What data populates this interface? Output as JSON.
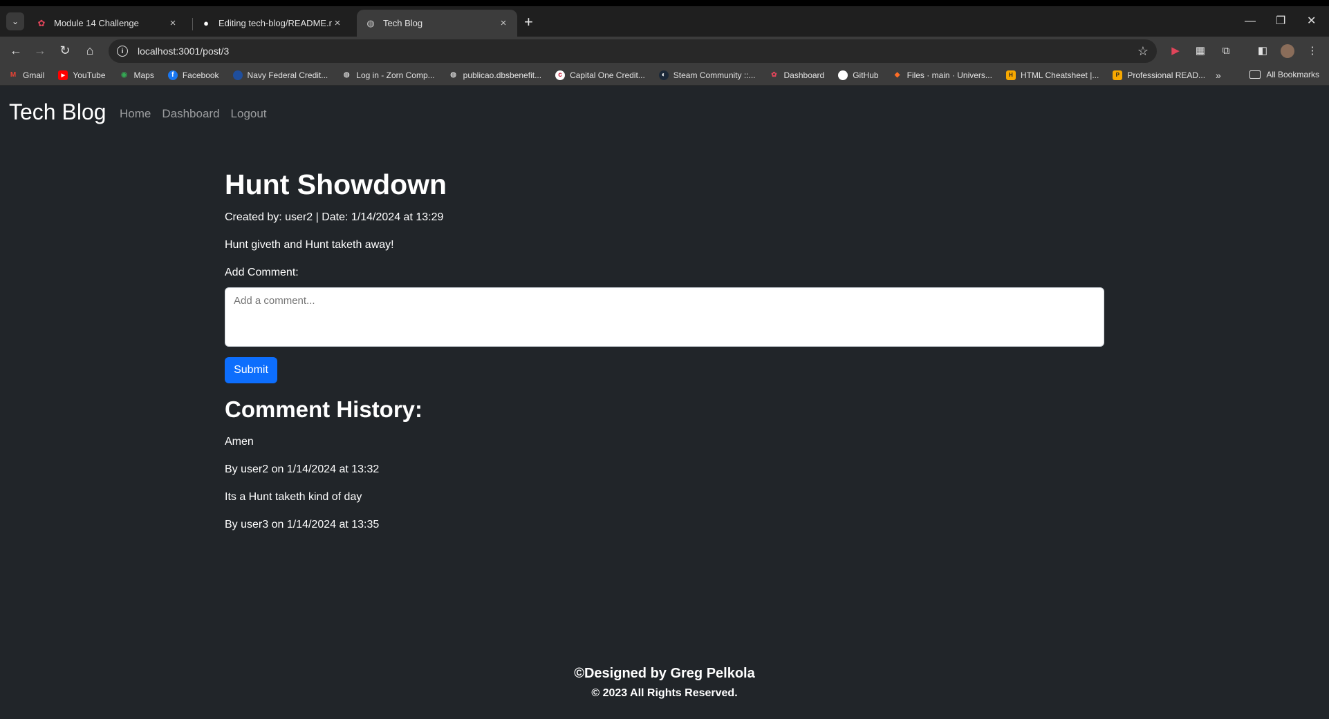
{
  "browser": {
    "tabs": [
      {
        "title": "Module 14 Challenge",
        "icon": "canvas-icon"
      },
      {
        "title": "Editing tech-blog/README.md",
        "icon": "github-icon"
      },
      {
        "title": "Tech Blog",
        "icon": "globe-icon"
      }
    ],
    "url": "localhost:3001/post/3",
    "bookmarks": [
      "Gmail",
      "YouTube",
      "Maps",
      "Facebook",
      "Navy Federal Credit...",
      "Log in - Zorn Comp...",
      "publicao.dbsbenefit...",
      "Capital One Credit...",
      "Steam Community ::...",
      "Dashboard",
      "GitHub",
      "Files · main · Univers...",
      "HTML Cheatsheet |...",
      "Professional READ..."
    ],
    "all_bookmarks": "All Bookmarks"
  },
  "nav": {
    "brand": "Tech Blog",
    "links": [
      "Home",
      "Dashboard",
      "Logout"
    ]
  },
  "post": {
    "title": "Hunt Showdown",
    "meta": "Created by: user2 | Date: 1/14/2024 at 13:29",
    "body": "Hunt giveth and Hunt taketh away!"
  },
  "comment_form": {
    "label": "Add Comment:",
    "placeholder": "Add a comment...",
    "submit": "Submit"
  },
  "history": {
    "title": "Comment History:",
    "lines": [
      "Amen",
      "By user2 on 1/14/2024 at 13:32",
      "Its a Hunt taketh kind of day",
      "By user3 on 1/14/2024 at 13:35"
    ]
  },
  "footer": {
    "designed": "©Designed by Greg Pelkola",
    "rights": "© 2023 All Rights Reserved."
  },
  "colors": {
    "page_bg": "#212529",
    "submit_bg": "#0d6efd"
  }
}
